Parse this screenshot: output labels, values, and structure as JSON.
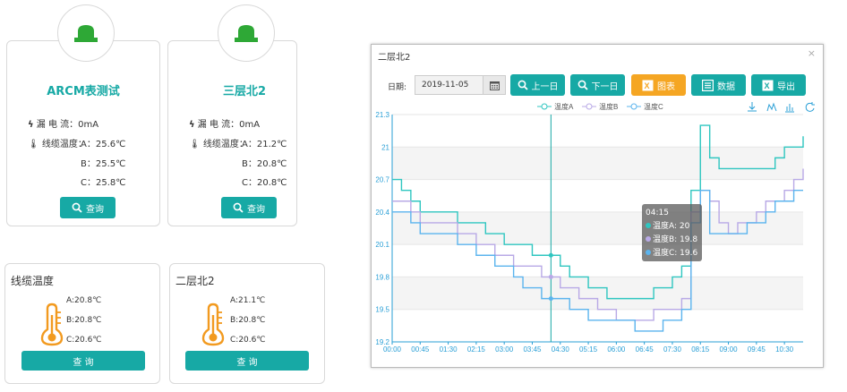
{
  "devices": [
    {
      "title": "ARCM表测试",
      "leak_label": "漏 电 流：",
      "leak_value": "0mA",
      "temp_label": "线缆温度：",
      "a_label": "A：",
      "a_value": "25.6℃",
      "b_label": "B：",
      "b_value": "25.5℃",
      "c_label": "C：",
      "c_value": "25.8℃",
      "query_label": "查询"
    },
    {
      "title": "三层北2",
      "leak_label": "漏 电 流：",
      "leak_value": "0mA",
      "temp_label": "线缆温度：",
      "a_label": "A：",
      "a_value": "21.2℃",
      "b_label": "B：",
      "b_value": "20.8℃",
      "c_label": "C：",
      "c_value": "20.8℃",
      "query_label": "查询"
    }
  ],
  "temp_cards": [
    {
      "title": "线缆温度",
      "a": "A:20.8℃",
      "b": "B:20.8℃",
      "c": "C:20.6℃",
      "query_label": "查 询"
    },
    {
      "title": "二层北2",
      "a": "A:21.1℃",
      "b": "B:20.8℃",
      "c": "C:20.6℃",
      "query_label": "查 询"
    }
  ],
  "modal": {
    "title": "二层北2",
    "close": "×",
    "date_label": "日期:",
    "date_value": "2019-11-05",
    "prev_label": "上一日",
    "next_label": "下一日",
    "chart_label": "图表",
    "data_label": "数据",
    "export_label": "导出",
    "tooltip": {
      "time": "04:15",
      "a": "温度A: 20",
      "b": "温度B: 19.8",
      "c": "温度C: 19.6"
    }
  },
  "colors": {
    "teal": "#17a9a5",
    "orange": "#f5a623",
    "seriesA": "#2fc6c0",
    "seriesB": "#b8a9e6",
    "seriesC": "#5bb4ee",
    "icon_green": "#2ea836",
    "thermo_orange": "#f29a1f"
  },
  "chart_data": {
    "type": "line",
    "x": [
      "00:00",
      "00:15",
      "00:30",
      "00:45",
      "01:00",
      "01:15",
      "01:30",
      "01:45",
      "02:00",
      "02:15",
      "02:30",
      "02:45",
      "03:00",
      "03:15",
      "03:30",
      "03:45",
      "04:00",
      "04:15",
      "04:30",
      "04:45",
      "05:00",
      "05:15",
      "05:30",
      "05:45",
      "06:00",
      "06:15",
      "06:30",
      "06:45",
      "07:00",
      "07:15",
      "07:30",
      "07:45",
      "08:00",
      "08:15",
      "08:30",
      "08:45",
      "09:00",
      "09:15",
      "09:30",
      "09:45",
      "10:00",
      "10:15",
      "10:30",
      "10:45",
      "11:00"
    ],
    "x_tick_labels": [
      "00:00",
      "00:45",
      "01:30",
      "02:15",
      "03:00",
      "03:45",
      "04:30",
      "05:15",
      "06:00",
      "06:45",
      "07:30",
      "08:15",
      "09:00",
      "09:45",
      "10:30"
    ],
    "series": [
      {
        "name": "温度A",
        "values": [
          20.7,
          20.6,
          20.5,
          20.4,
          20.4,
          20.4,
          20.4,
          20.3,
          20.3,
          20.3,
          20.2,
          20.2,
          20.1,
          20.1,
          20.1,
          20.0,
          20.0,
          20.0,
          19.9,
          19.8,
          19.8,
          19.7,
          19.7,
          19.6,
          19.6,
          19.6,
          19.6,
          19.6,
          19.7,
          19.7,
          19.8,
          19.9,
          20.6,
          21.2,
          20.9,
          20.8,
          20.8,
          20.8,
          20.8,
          20.8,
          20.8,
          20.9,
          21.0,
          21.0,
          21.1
        ]
      },
      {
        "name": "温度B",
        "values": [
          20.5,
          20.5,
          20.4,
          20.3,
          20.3,
          20.3,
          20.3,
          20.2,
          20.2,
          20.1,
          20.1,
          20.0,
          20.0,
          19.9,
          19.9,
          19.9,
          19.8,
          19.8,
          19.7,
          19.7,
          19.6,
          19.6,
          19.5,
          19.5,
          19.4,
          19.4,
          19.4,
          19.4,
          19.5,
          19.5,
          19.5,
          19.6,
          20.4,
          20.6,
          20.5,
          20.3,
          20.2,
          20.3,
          20.3,
          20.4,
          20.5,
          20.5,
          20.6,
          20.7,
          20.8
        ]
      },
      {
        "name": "温度C",
        "values": [
          20.4,
          20.4,
          20.3,
          20.2,
          20.2,
          20.2,
          20.2,
          20.1,
          20.1,
          20.0,
          20.0,
          19.9,
          19.9,
          19.8,
          19.7,
          19.7,
          19.6,
          19.6,
          19.6,
          19.5,
          19.5,
          19.4,
          19.4,
          19.4,
          19.4,
          19.4,
          19.3,
          19.3,
          19.3,
          19.4,
          19.4,
          19.5,
          20.3,
          20.6,
          20.2,
          20.2,
          20.2,
          20.2,
          20.3,
          20.3,
          20.4,
          20.5,
          20.5,
          20.6,
          20.6
        ]
      }
    ],
    "ylim": [
      19.2,
      21.3
    ],
    "y_ticks": [
      19.2,
      19.5,
      19.8,
      20.1,
      20.4,
      20.7,
      21,
      21.3
    ],
    "marker_x": "04:15",
    "legend_position": "top-center",
    "grid": true
  }
}
